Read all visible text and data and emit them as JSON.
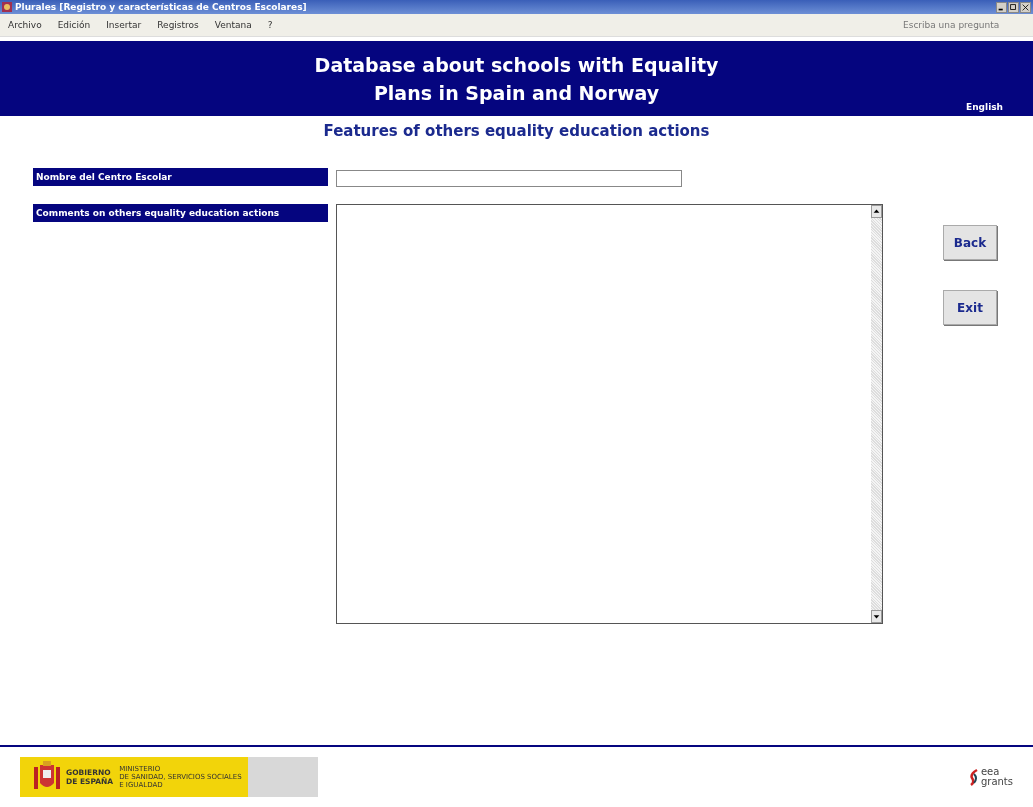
{
  "window": {
    "title": "Plurales  [Registro y características de Centros Escolares]"
  },
  "menu": [
    "Archivo",
    "Edición",
    "Insertar",
    "Registros",
    "Ventana",
    "?"
  ],
  "help_box": {
    "placeholder": "Escriba una pregunta"
  },
  "header": {
    "title_lines": [
      "Database about schools with Equality",
      "Plans in Spain and Norway"
    ],
    "language_link": "English"
  },
  "subtitle": "Features of others equality education actions",
  "fields": [
    {
      "kind": "line",
      "label": "Nombre del Centro Escolar"
    },
    {
      "kind": "area",
      "label": "Comments on others equality education actions"
    }
  ],
  "buttons": [
    "Back",
    "Exit"
  ],
  "footer": {
    "gov_lines": [
      "GOBIERNO",
      "DE ESPAÑA"
    ],
    "ministry_lines": [
      "MINISTERIO",
      "DE SANIDAD, SERVICIOS SOCIALES",
      "E IGUALDAD"
    ],
    "eea_lines": [
      "eea",
      "grants"
    ]
  }
}
